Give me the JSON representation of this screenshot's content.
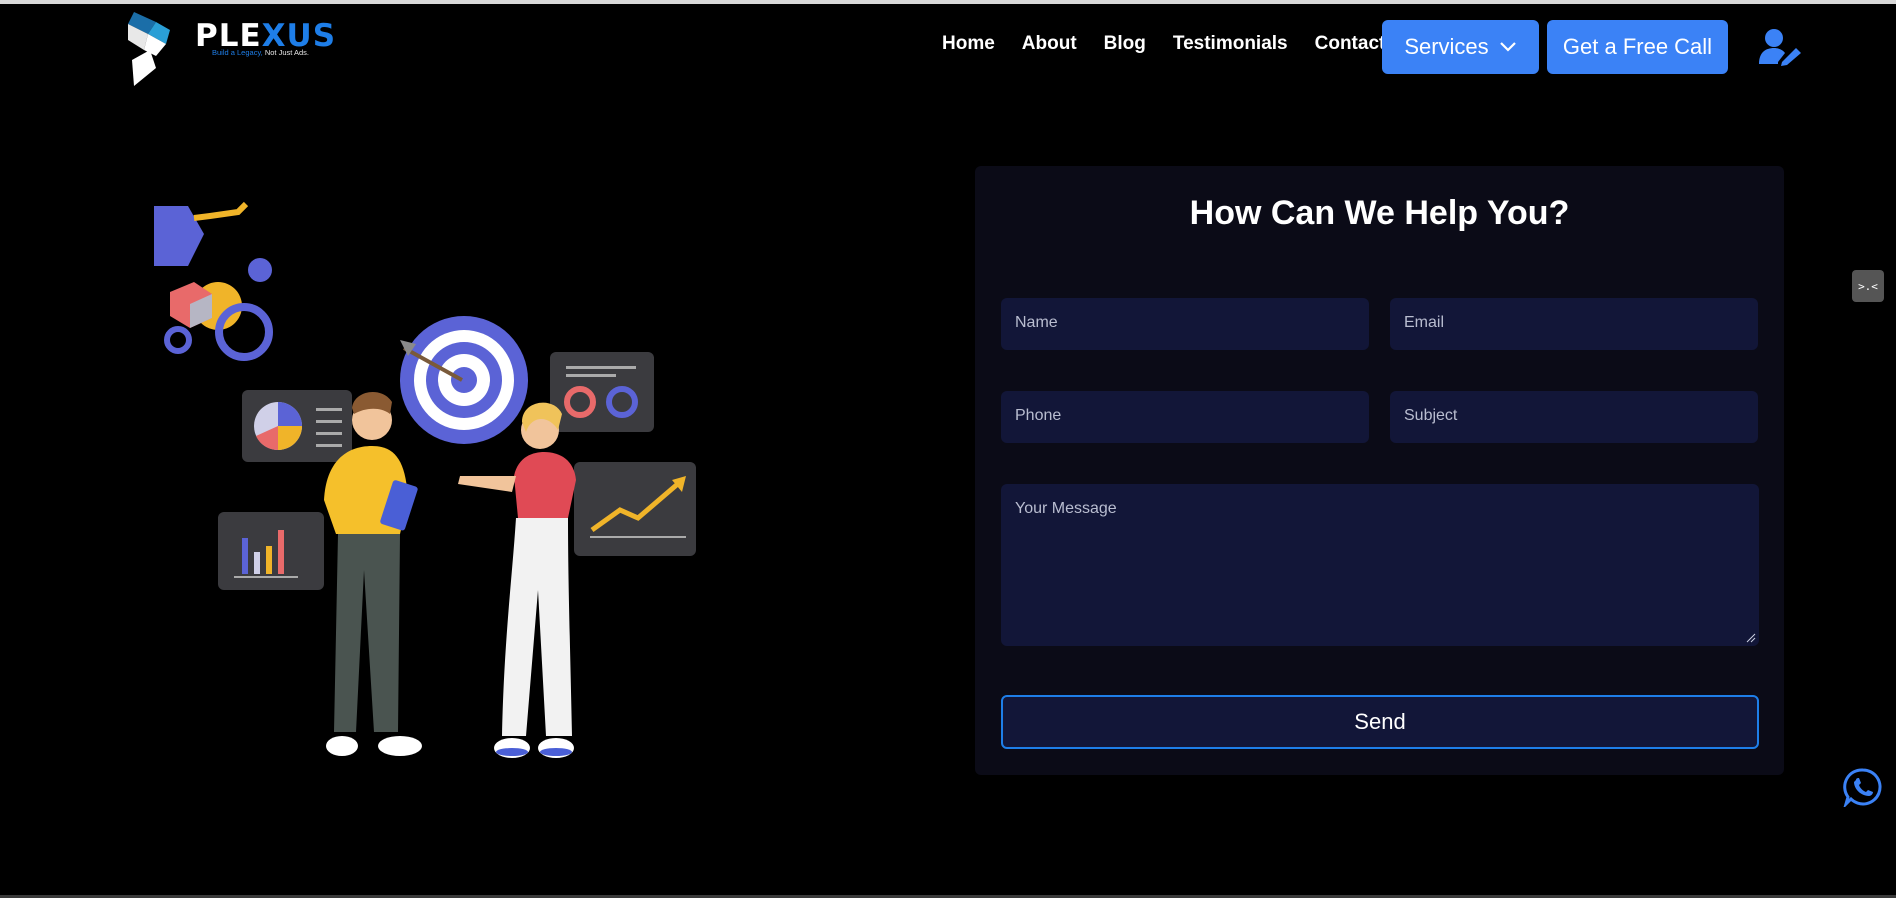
{
  "brand": {
    "name_part1": "PLE",
    "name_part2": "XUS",
    "tagline_part1": "Build a Legacy,",
    "tagline_part2": "Not Just Ads."
  },
  "nav": {
    "items": [
      "Home",
      "About",
      "Blog",
      "Testimonials",
      "Contact"
    ]
  },
  "header": {
    "services_label": "Services",
    "call_label": "Get a Free Call"
  },
  "form": {
    "title": "How Can We Help You?",
    "name_placeholder": "Name",
    "email_placeholder": "Email",
    "phone_placeholder": "Phone",
    "subject_placeholder": "Subject",
    "message_placeholder": "Your Message",
    "send_label": "Send"
  },
  "side_tab": {
    "label": ">.<"
  },
  "icons": [
    "logo-mark",
    "chevron-down-icon",
    "user-edit-icon",
    "whatsapp-icon"
  ],
  "colors": {
    "accent": "#3b82f6",
    "panel": "#0b0b17",
    "field": "#121638",
    "border": "#1e7ee8"
  }
}
